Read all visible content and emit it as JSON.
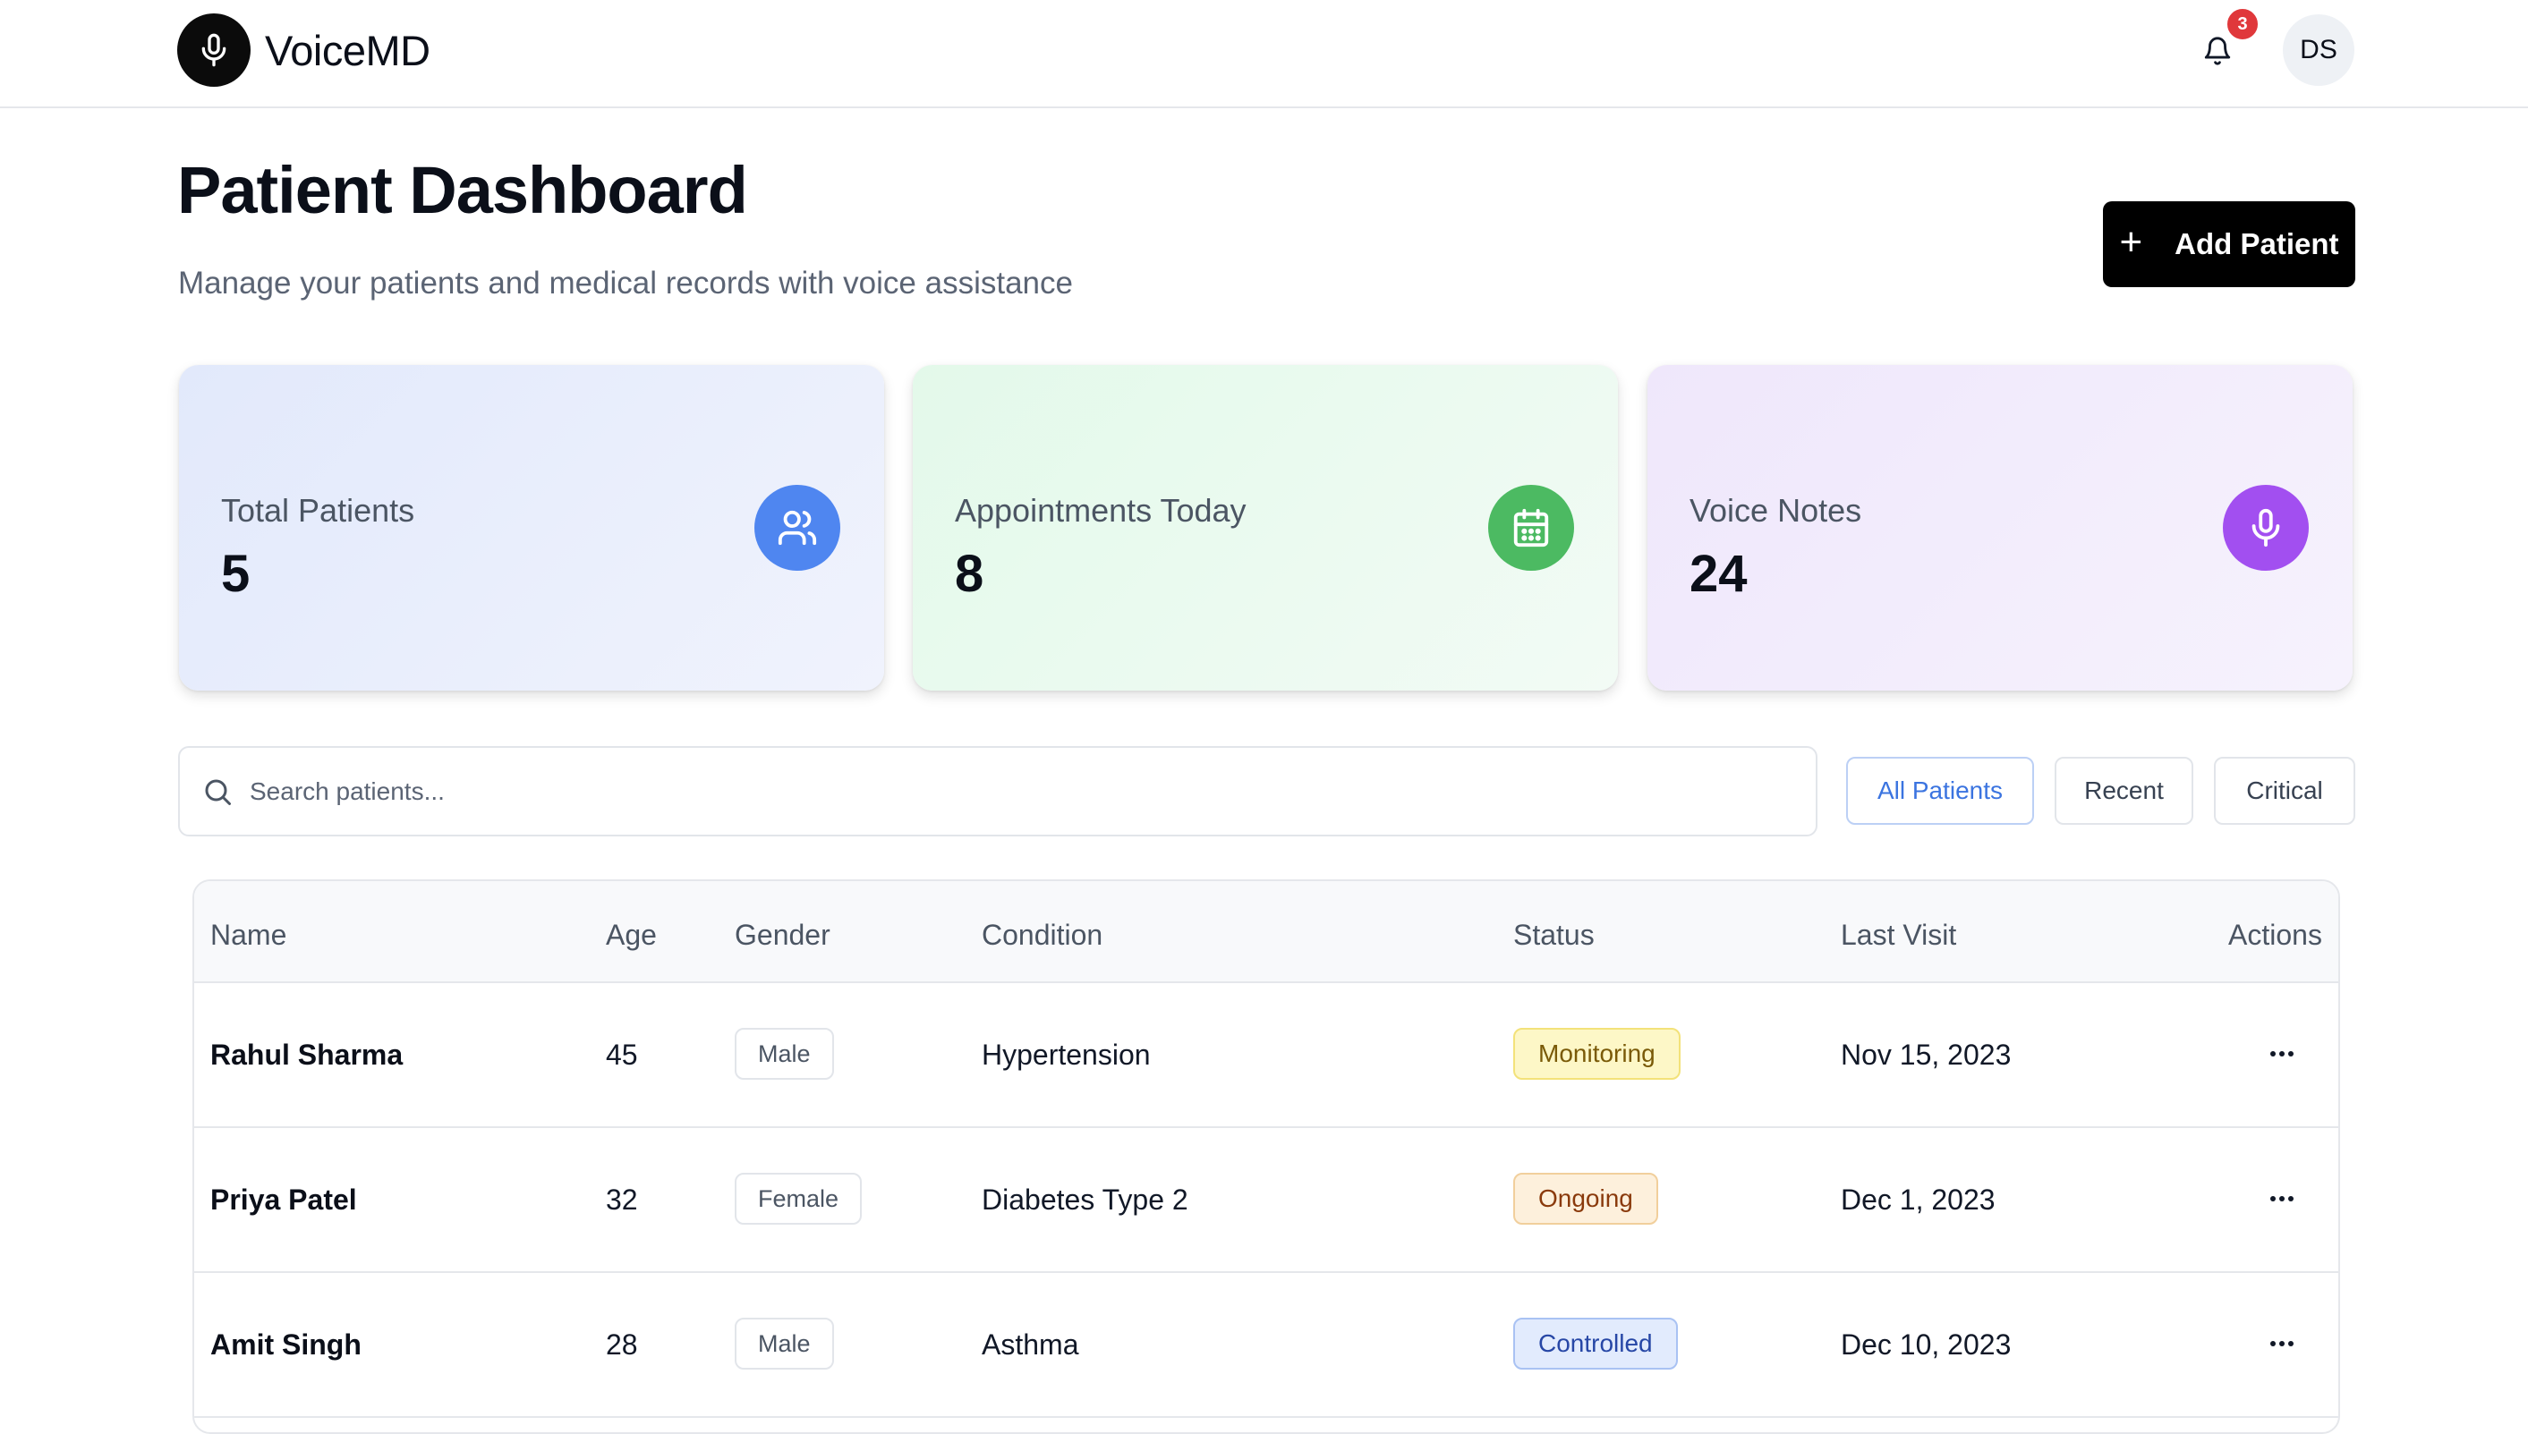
{
  "app": {
    "name": "VoiceMD"
  },
  "header": {
    "notification_count": "3",
    "avatar_initials": "DS"
  },
  "page": {
    "title": "Patient Dashboard",
    "subtitle": "Manage your patients and medical records with voice assistance",
    "add_button": "Add Patient"
  },
  "stats": [
    {
      "label": "Total Patients",
      "value": "5",
      "icon": "users-icon",
      "color": "#4f86f0"
    },
    {
      "label": "Appointments Today",
      "value": "8",
      "icon": "calendar-icon",
      "color": "#4cba62"
    },
    {
      "label": "Voice Notes",
      "value": "24",
      "icon": "microphone-icon",
      "color": "#a24ff0"
    }
  ],
  "search": {
    "placeholder": "Search patients..."
  },
  "filters": [
    {
      "label": "All Patients",
      "active": true
    },
    {
      "label": "Recent",
      "active": false
    },
    {
      "label": "Critical",
      "active": false
    }
  ],
  "table": {
    "columns": [
      "Name",
      "Age",
      "Gender",
      "Condition",
      "Status",
      "Last Visit",
      "Actions"
    ],
    "rows": [
      {
        "name": "Rahul Sharma",
        "age": "45",
        "gender": "Male",
        "condition": "Hypertension",
        "status": "Monitoring",
        "status_color": "#fdf7c7",
        "last_visit": "Nov 15, 2023"
      },
      {
        "name": "Priya Patel",
        "age": "32",
        "gender": "Female",
        "condition": "Diabetes Type 2",
        "status": "Ongoing",
        "status_color": "#fdf0dc",
        "last_visit": "Dec 1, 2023"
      },
      {
        "name": "Amit Singh",
        "age": "28",
        "gender": "Male",
        "condition": "Asthma",
        "status": "Controlled",
        "status_color": "#e2ebfd",
        "last_visit": "Dec 10, 2023"
      }
    ]
  }
}
